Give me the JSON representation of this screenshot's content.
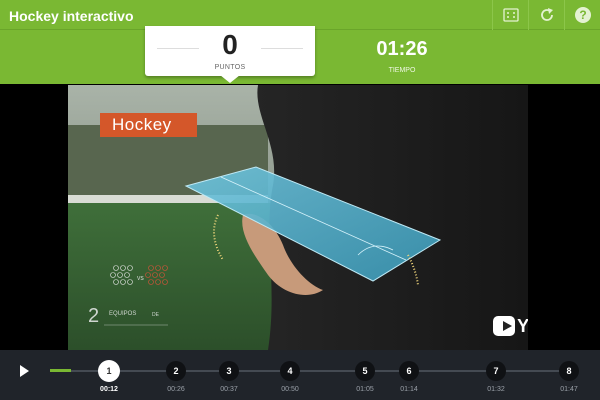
{
  "app": {
    "title": "Hockey interactivo",
    "accent": "#7ab833",
    "toolbar": [
      {
        "name": "fullscreen-icon"
      },
      {
        "name": "restart-icon"
      },
      {
        "name": "help-icon"
      }
    ]
  },
  "score": {
    "value": "0",
    "label": "PUNTOS"
  },
  "timer": {
    "value": "01:26",
    "label": "TIEMPO"
  },
  "video": {
    "overlay_title": "Hockey",
    "teams_number": "2",
    "teams_label": "EQUIPOS",
    "teams_suffix": "DE",
    "vs_label": "VS",
    "provider": "YouTube"
  },
  "player": {
    "progress": 0.12,
    "checkpoints": [
      {
        "label": "1",
        "time": "00:12",
        "active": true
      },
      {
        "label": "2",
        "time": "00:26",
        "active": false
      },
      {
        "label": "3",
        "time": "00:37",
        "active": false
      },
      {
        "label": "4",
        "time": "00:50",
        "active": false
      },
      {
        "label": "5",
        "time": "01:05",
        "active": false
      },
      {
        "label": "6",
        "time": "01:14",
        "active": false
      },
      {
        "label": "7",
        "time": "01:32",
        "active": false
      },
      {
        "label": "8",
        "time": "01:47",
        "active": false
      }
    ]
  }
}
